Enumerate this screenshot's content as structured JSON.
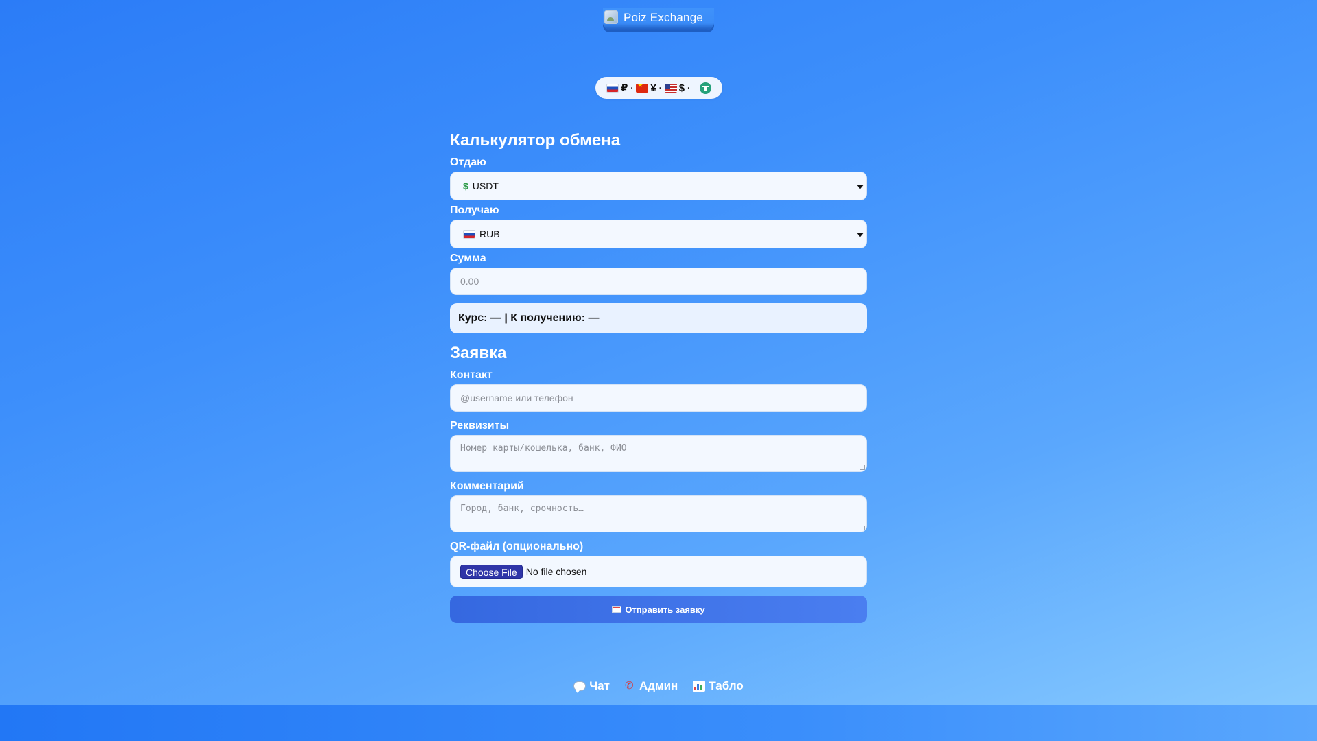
{
  "header": {
    "brand_name": "Poiz Exchange"
  },
  "ticker": {
    "items": [
      {
        "symbol": "₽"
      },
      {
        "symbol": "¥"
      },
      {
        "symbol": "$"
      }
    ],
    "separator": "·"
  },
  "calculator": {
    "title": "Калькулятор обмена",
    "give_label": "Отдаю",
    "give_value": "USDT",
    "receive_label": "Получаю",
    "receive_value": "RUB",
    "amount_label": "Сумма",
    "amount_placeholder": "0.00",
    "rate_text": "Курс: — | К получению: —"
  },
  "order": {
    "title": "Заявка",
    "contact_label": "Контакт",
    "contact_placeholder": "@username или телефон",
    "details_label": "Реквизиты",
    "details_placeholder": "Номер карты/кошелька, банк, ФИО",
    "comment_label": "Комментарий",
    "comment_placeholder": "Город, банк, срочность…",
    "qr_label": "QR-файл (опционально)",
    "file_button": "Choose File",
    "file_status": "No file chosen",
    "submit_label": "Отправить заявку"
  },
  "footer": {
    "chat": "Чат",
    "admin": "Админ",
    "board": "Табло"
  },
  "colors": {
    "accent": "#3568e0",
    "background_top": "#2b7cf7",
    "background_bottom": "#86c9fe",
    "tether": "#26a17b"
  }
}
